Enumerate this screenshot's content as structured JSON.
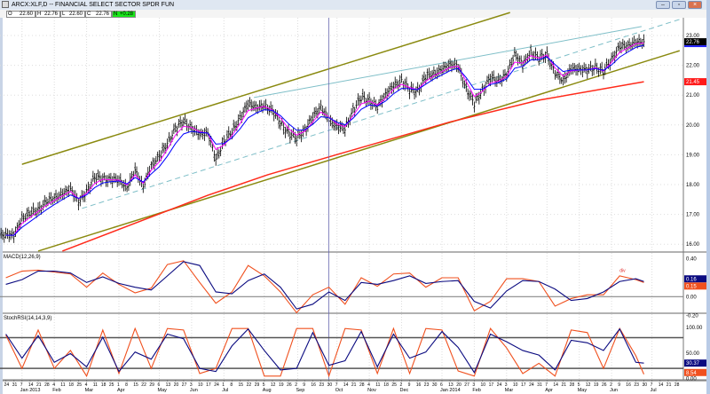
{
  "window": {
    "title": "ARCX:XLF,D -- FINANCIAL SELECT SECTOR SPDR FUN",
    "buttons": [
      "minimize",
      "restore",
      "close"
    ]
  },
  "quote": {
    "fields": [
      {
        "key": "O",
        "value": "22.60"
      },
      {
        "key": "H",
        "value": "22.76"
      },
      {
        "key": "L",
        "value": "22.60"
      },
      {
        "key": "C",
        "value": "22.76"
      },
      {
        "key": "N",
        "value": "+0.28"
      }
    ]
  },
  "colors": {
    "price_bars": "#000000",
    "ema_fast": "#ff00ff",
    "ema_slow": "#0000ff",
    "ma_long": "#ff2a1a",
    "channel": "#8a8a10",
    "trend_cyan": "#7fbfc8",
    "macd": "#f0501e",
    "signal": "#0a0a80",
    "stoch_k": "#f0501e",
    "stoch_d": "#0a0a80"
  },
  "chart_data": {
    "type": "ohlc",
    "price_pane": {
      "ylim": [
        15.7,
        23.6
      ],
      "y_ticks": [
        "16.00",
        "17.00",
        "18.00",
        "19.00",
        "20.00",
        "21.00",
        "22.00",
        "23.00"
      ],
      "dates": [
        "2012-12-24",
        "2012-12-31",
        "2013-01-07",
        "2013-01-14",
        "2013-01-21",
        "2013-01-28",
        "2013-02-04",
        "2013-02-11",
        "2013-02-18",
        "2013-02-25",
        "2013-03-04",
        "2013-03-11",
        "2013-03-18",
        "2013-03-25",
        "2013-04-01",
        "2013-04-08",
        "2013-04-15",
        "2013-04-22",
        "2013-04-29",
        "2013-05-06",
        "2013-05-13",
        "2013-05-20",
        "2013-05-27",
        "2013-06-03",
        "2013-06-10",
        "2013-06-17",
        "2013-06-24",
        "2013-07-01",
        "2013-07-08",
        "2013-07-15",
        "2013-07-22",
        "2013-07-29",
        "2013-08-05",
        "2013-08-12",
        "2013-08-19",
        "2013-08-26",
        "2013-09-02",
        "2013-09-09",
        "2013-09-16",
        "2013-09-23",
        "2013-09-30",
        "2013-10-07",
        "2013-10-14",
        "2013-10-21",
        "2013-10-28",
        "2013-11-04",
        "2013-11-11",
        "2013-11-18",
        "2013-11-25",
        "2013-12-02",
        "2013-12-09",
        "2013-12-16",
        "2013-12-23",
        "2013-12-30",
        "2014-01-06",
        "2014-01-13",
        "2014-01-20",
        "2014-01-27",
        "2014-02-03",
        "2014-02-10",
        "2014-02-17",
        "2014-02-24",
        "2014-03-03",
        "2014-03-10",
        "2014-03-17",
        "2014-03-24",
        "2014-03-31",
        "2014-04-07",
        "2014-04-14",
        "2014-04-21",
        "2014-04-28",
        "2014-05-05",
        "2014-05-12",
        "2014-05-19",
        "2014-05-26",
        "2014-06-02",
        "2014-06-09",
        "2014-06-16",
        "2014-06-23",
        "2014-06-30"
      ],
      "close": [
        16.3,
        16.3,
        16.9,
        17.0,
        17.2,
        17.4,
        17.55,
        17.7,
        17.85,
        17.4,
        17.8,
        18.2,
        18.25,
        18.15,
        18.15,
        17.9,
        18.5,
        17.9,
        18.7,
        18.9,
        19.4,
        19.9,
        20.1,
        19.9,
        19.7,
        19.7,
        18.9,
        19.4,
        19.8,
        20.25,
        20.7,
        20.6,
        20.65,
        20.45,
        20.1,
        19.7,
        19.55,
        19.85,
        20.25,
        20.6,
        20.2,
        19.9,
        19.9,
        20.5,
        20.9,
        20.85,
        20.6,
        21.0,
        21.35,
        21.45,
        21.2,
        21.15,
        21.6,
        21.75,
        21.85,
        22.0,
        22.0,
        21.2,
        20.7,
        21.2,
        21.55,
        21.5,
        21.7,
        22.35,
        22.05,
        22.45,
        22.2,
        22.4,
        21.7,
        21.5,
        21.9,
        21.85,
        21.85,
        21.95,
        21.75,
        22.25,
        22.6,
        22.65,
        22.8,
        22.76
      ],
      "last_price": "22.76",
      "long_ma": {
        "points": [
          [
            "2013-02-11",
            15.77
          ],
          [
            "2013-06-17",
            17.64
          ],
          [
            "2013-08-08",
            18.33
          ],
          [
            "2013-10-10",
            19.04
          ],
          [
            "2014-01-13",
            20.1
          ],
          [
            "2014-03-31",
            20.83
          ],
          [
            "2014-06-30",
            21.45
          ]
        ],
        "last": "21.45"
      },
      "trendlines": [
        {
          "kind": "channel-upper",
          "from": [
            "2013-01-07",
            18.68
          ],
          "to": [
            "2014-03-06",
            23.77
          ]
        },
        {
          "kind": "channel-lower",
          "from": [
            "2013-01-21",
            15.77
          ],
          "to": [
            "2014-07-31",
            22.49
          ]
        },
        {
          "kind": "cyan-solid",
          "from": [
            "2013-07-27",
            20.92
          ],
          "to": [
            "2014-06-28",
            23.3
          ]
        },
        {
          "kind": "cyan-dashed",
          "from": [
            "2013-02-28",
            17.2
          ],
          "to": [
            "2014-07-31",
            23.54
          ]
        }
      ],
      "cursor_date": "2013-09-30"
    },
    "macd_pane": {
      "title": "MACD(12,26,9)",
      "ylim": [
        -0.27,
        0.45
      ],
      "y_ticks": [
        "0.40",
        "0.00",
        "-0.20"
      ],
      "dates": [
        "2012-12-24",
        "2013-01-07",
        "2013-01-21",
        "2013-02-04",
        "2013-02-18",
        "2013-03-04",
        "2013-03-18",
        "2013-04-01",
        "2013-04-15",
        "2013-04-29",
        "2013-05-13",
        "2013-05-27",
        "2013-06-10",
        "2013-06-24",
        "2013-07-08",
        "2013-07-22",
        "2013-08-05",
        "2013-08-19",
        "2013-09-02",
        "2013-09-16",
        "2013-09-30",
        "2013-10-14",
        "2013-10-28",
        "2013-11-11",
        "2013-11-25",
        "2013-12-09",
        "2013-12-23",
        "2014-01-06",
        "2014-01-20",
        "2014-02-03",
        "2014-02-17",
        "2014-03-03",
        "2014-03-17",
        "2014-03-31",
        "2014-04-14",
        "2014-04-28",
        "2014-05-12",
        "2014-05-26",
        "2014-06-09",
        "2014-06-23",
        "2014-06-30"
      ],
      "macd": [
        0.2,
        0.27,
        0.28,
        0.26,
        0.24,
        0.1,
        0.25,
        0.13,
        0.04,
        0.09,
        0.34,
        0.38,
        0.15,
        -0.07,
        0.05,
        0.33,
        0.22,
        0.05,
        -0.17,
        0.02,
        0.1,
        -0.08,
        0.2,
        0.11,
        0.24,
        0.25,
        0.1,
        0.2,
        0.2,
        -0.15,
        -0.05,
        0.19,
        0.19,
        0.16,
        -0.1,
        -0.02,
        0.02,
        0.02,
        0.22,
        0.18,
        0.15
      ],
      "signal": [
        0.13,
        0.18,
        0.27,
        0.27,
        0.25,
        0.15,
        0.21,
        0.14,
        0.1,
        0.07,
        0.22,
        0.37,
        0.33,
        0.05,
        0.03,
        0.17,
        0.24,
        0.1,
        -0.13,
        -0.08,
        0.05,
        -0.04,
        0.15,
        0.13,
        0.17,
        0.22,
        0.14,
        0.16,
        0.17,
        -0.05,
        -0.12,
        0.06,
        0.17,
        0.16,
        0.08,
        -0.04,
        -0.02,
        0.05,
        0.16,
        0.19,
        0.16
      ],
      "last_signal": "0.16",
      "last_macd": "0.15",
      "annotation": {
        "text": "div",
        "date": "2014-06-09",
        "value": 0.26
      }
    },
    "stoch_pane": {
      "title": "StochRSI(14,14,3,9)",
      "ylim": [
        0,
        100
      ],
      "y_ticks": [
        "100.00",
        "50.00",
        "0.00"
      ],
      "levels": [
        80,
        20
      ],
      "dates": [
        "2012-12-24",
        "2013-01-07",
        "2013-01-21",
        "2013-02-04",
        "2013-02-18",
        "2013-03-04",
        "2013-03-18",
        "2013-04-01",
        "2013-04-15",
        "2013-04-29",
        "2013-05-13",
        "2013-05-27",
        "2013-06-10",
        "2013-06-24",
        "2013-07-08",
        "2013-07-22",
        "2013-08-05",
        "2013-08-19",
        "2013-09-02",
        "2013-09-16",
        "2013-09-30",
        "2013-10-14",
        "2013-10-28",
        "2013-11-11",
        "2013-11-25",
        "2013-12-09",
        "2013-12-23",
        "2014-01-06",
        "2014-01-20",
        "2014-02-03",
        "2014-02-17",
        "2014-03-03",
        "2014-03-17",
        "2014-03-31",
        "2014-04-14",
        "2014-04-28",
        "2014-05-12",
        "2014-05-26",
        "2014-06-09",
        "2014-06-23",
        "2014-06-30"
      ],
      "k": [
        85,
        20,
        95,
        20,
        55,
        5,
        95,
        10,
        98,
        20,
        98,
        95,
        10,
        20,
        98,
        98,
        5,
        5,
        98,
        98,
        5,
        98,
        95,
        10,
        98,
        10,
        98,
        95,
        15,
        5,
        98,
        60,
        10,
        30,
        5,
        95,
        90,
        20,
        98,
        45,
        8.54
      ],
      "d": [
        87,
        40,
        84,
        32,
        49,
        23,
        81,
        14,
        52,
        38,
        87,
        78,
        20,
        14,
        64,
        97,
        55,
        17,
        20,
        90,
        26,
        35,
        92,
        23,
        87,
        40,
        52,
        92,
        61,
        12,
        87,
        72,
        55,
        46,
        17,
        75,
        70,
        55,
        97,
        32,
        30.37
      ],
      "last_d": "30.37",
      "last_k": "8.54"
    },
    "x_axis": {
      "weeks": [
        "2012-12-24",
        "2012-12-31",
        "2013-01-07",
        "2013-01-14",
        "2013-01-21",
        "2013-01-28",
        "2013-02-04",
        "2013-02-11",
        "2013-02-18",
        "2013-02-25",
        "2013-03-04",
        "2013-03-11",
        "2013-03-18",
        "2013-03-25",
        "2013-04-01",
        "2013-04-08",
        "2013-04-15",
        "2013-04-22",
        "2013-04-29",
        "2013-05-06",
        "2013-05-13",
        "2013-05-20",
        "2013-05-27",
        "2013-06-03",
        "2013-06-10",
        "2013-06-17",
        "2013-06-24",
        "2013-07-01",
        "2013-07-08",
        "2013-07-15",
        "2013-07-22",
        "2013-07-29",
        "2013-08-05",
        "2013-08-12",
        "2013-08-19",
        "2013-08-26",
        "2013-09-02",
        "2013-09-09",
        "2013-09-16",
        "2013-09-23",
        "2013-09-30",
        "2013-10-07",
        "2013-10-14",
        "2013-10-21",
        "2013-10-28",
        "2013-11-04",
        "2013-11-11",
        "2013-11-18",
        "2013-11-25",
        "2013-12-02",
        "2013-12-09",
        "2013-12-16",
        "2013-12-23",
        "2013-12-30",
        "2014-01-06",
        "2014-01-13",
        "2014-01-20",
        "2014-01-27",
        "2014-02-03",
        "2014-02-10",
        "2014-02-17",
        "2014-02-24",
        "2014-03-03",
        "2014-03-10",
        "2014-03-17",
        "2014-03-24",
        "2014-03-31",
        "2014-04-07",
        "2014-04-14",
        "2014-04-21",
        "2014-04-28",
        "2014-05-05",
        "2014-05-12",
        "2014-05-19",
        "2014-05-26",
        "2014-06-02",
        "2014-06-09",
        "2014-06-16",
        "2014-06-23",
        "2014-06-30",
        "2014-07-07",
        "2014-07-14",
        "2014-07-21",
        "2014-07-28"
      ],
      "months": [
        {
          "label": "Jan 2013",
          "date": "2013-01-07"
        },
        {
          "label": "Feb",
          "date": "2013-02-04"
        },
        {
          "label": "Mar",
          "date": "2013-03-04"
        },
        {
          "label": "Apr",
          "date": "2013-04-01"
        },
        {
          "label": "May",
          "date": "2013-05-06"
        },
        {
          "label": "Jun",
          "date": "2013-06-03"
        },
        {
          "label": "Jul",
          "date": "2013-07-01"
        },
        {
          "label": "Aug",
          "date": "2013-08-05"
        },
        {
          "label": "Sep",
          "date": "2013-09-03"
        },
        {
          "label": "Oct",
          "date": "2013-10-07"
        },
        {
          "label": "Nov",
          "date": "2013-11-04"
        },
        {
          "label": "Dec",
          "date": "2013-12-02"
        },
        {
          "label": "Jan 2014",
          "date": "2014-01-06"
        },
        {
          "label": "Feb",
          "date": "2014-02-03"
        },
        {
          "label": "Mar",
          "date": "2014-03-03"
        },
        {
          "label": "Apr",
          "date": "2014-04-07"
        },
        {
          "label": "May",
          "date": "2014-05-05"
        },
        {
          "label": "Jun",
          "date": "2014-06-02"
        },
        {
          "label": "Jul",
          "date": "2014-07-07"
        }
      ]
    }
  }
}
